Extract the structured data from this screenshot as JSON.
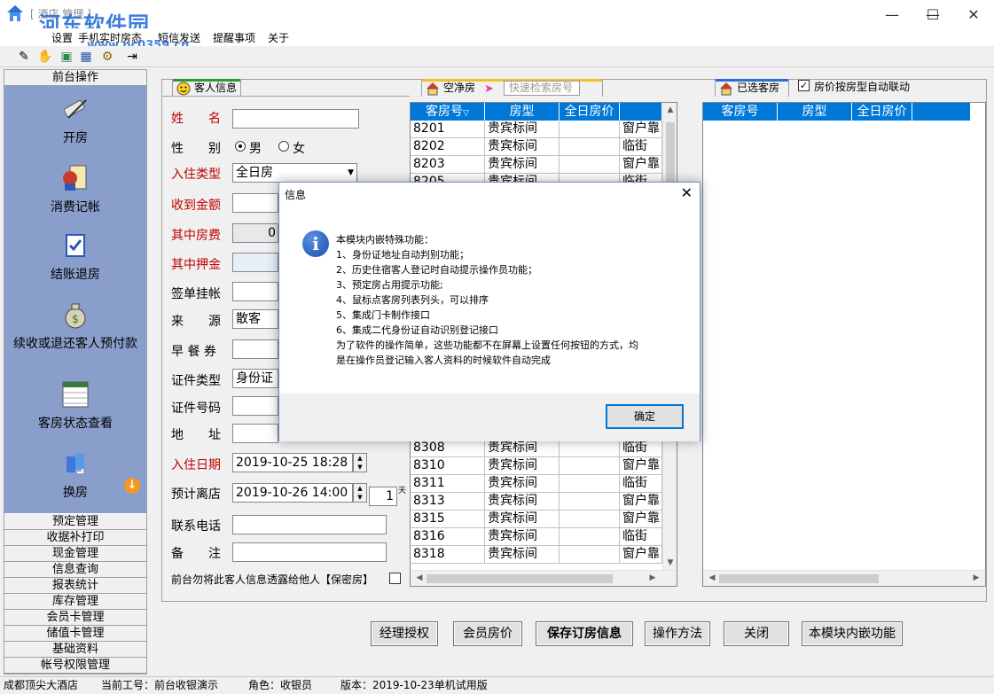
{
  "window": {
    "title_visible": "[ 酒店 管理 ]",
    "watermark": "河东软件园",
    "watermark_url": "www.pc0359.cn"
  },
  "menu": [
    "设置",
    "手机实时房态",
    "短信发送",
    "提醒事项",
    "关于"
  ],
  "toolbar_icons": [
    "ruler-icon",
    "hand-icon",
    "cylinder-icon",
    "grid-icon",
    "gear-icon",
    "exit-icon"
  ],
  "left": {
    "header": "前台操作",
    "actions": [
      "开房",
      "消费记帐",
      "结账退房",
      "续收或退还客人预付款",
      "客房状态查看",
      "换房"
    ],
    "list": [
      "预定管理",
      "收据补打印",
      "现金管理",
      "信息查询",
      "报表统计",
      "库存管理",
      "会员卡管理",
      "储值卡管理",
      "基础资料",
      "帐号权限管理"
    ]
  },
  "guest": {
    "tab": "客人信息",
    "name_label": "姓　　名",
    "name_value": "",
    "gender_label": "性　　别",
    "gender_male": "男",
    "gender_female": "女",
    "checkin_type_label": "入住类型",
    "checkin_type_value": "全日房",
    "received_label": "收到金额",
    "room_fee_label": "其中房费",
    "room_fee_value": "0",
    "deposit_label": "其中押金",
    "sign_label": "签单挂帐",
    "source_label": "来　　源",
    "source_value": "散客",
    "breakfast_label": "早 餐 券",
    "id_type_label": "证件类型",
    "id_type_value": "身份证",
    "id_no_label": "证件号码",
    "address_label": "地　　址",
    "checkin_date_label": "入住日期",
    "checkin_date_value": "2019-10-25 18:28",
    "checkout_label": "预计离店",
    "checkout_value": "2019-10-26 14:00",
    "days_value": "1",
    "days_unit": "天",
    "phone_label": "联系电话",
    "remark_label": "备　　注",
    "privacy_note": "前台勿将此客人信息透露给他人【保密房】"
  },
  "vacant": {
    "tab": "空净房",
    "search_placeholder": "快速检索房号",
    "columns": [
      "客房号",
      "房型",
      "全日房价",
      ""
    ],
    "sort_indicator": "▽",
    "rows_top": [
      [
        "8201",
        "贵宾标间",
        "",
        "窗户靠"
      ],
      [
        "8202",
        "贵宾标间",
        "",
        "临街"
      ],
      [
        "8203",
        "贵宾标间",
        "",
        "窗户靠"
      ],
      [
        "8205",
        "贵宾标间",
        "",
        "临街"
      ]
    ],
    "rows_bottom": [
      [
        "8308",
        "贵宾标间",
        "",
        "临街"
      ],
      [
        "8310",
        "贵宾标间",
        "",
        "窗户靠"
      ],
      [
        "8311",
        "贵宾标间",
        "",
        "临街"
      ],
      [
        "8313",
        "贵宾标间",
        "",
        "窗户靠"
      ],
      [
        "8315",
        "贵宾标间",
        "",
        "窗户靠"
      ],
      [
        "8316",
        "贵宾标间",
        "",
        "临街"
      ],
      [
        "8318",
        "贵宾标间",
        "",
        "窗户靠"
      ]
    ]
  },
  "selected": {
    "tab": "已选客房",
    "auto_link_label": "房价按房型自动联动",
    "columns": [
      "客房号",
      "房型",
      "全日房价",
      ""
    ]
  },
  "buttons": [
    "经理授权",
    "会员房价",
    "保存订房信息",
    "操作方法",
    "关闭",
    "本模块内嵌功能"
  ],
  "status": {
    "hotel": "成都顶尖大酒店",
    "operator": "当前工号：前台收银演示",
    "role": "角色：收银员",
    "version": "版本：2019-10-23单机试用版"
  },
  "dialog": {
    "title": "信息",
    "lines": [
      "本模块内嵌特殊功能：",
      "1、身份证地址自动判别功能；",
      "2、历史住宿客人登记时自动提示操作员功能；",
      "3、预定房占用提示功能;",
      "4、鼠标点客房列表列头，可以排序",
      "5、集成门卡制作接口",
      "6、集成二代身份证自动识别登记接口",
      "为了软件的操作简单，这些功能都不在屏幕上设置任何按钮的方式，均",
      "是在操作员登记输入客人资料的时候软件自动完成"
    ],
    "ok": "确定"
  },
  "colors": {
    "accent": "#0078d7",
    "sidebar": "#8a9ecb",
    "required_label": "#c00000"
  }
}
